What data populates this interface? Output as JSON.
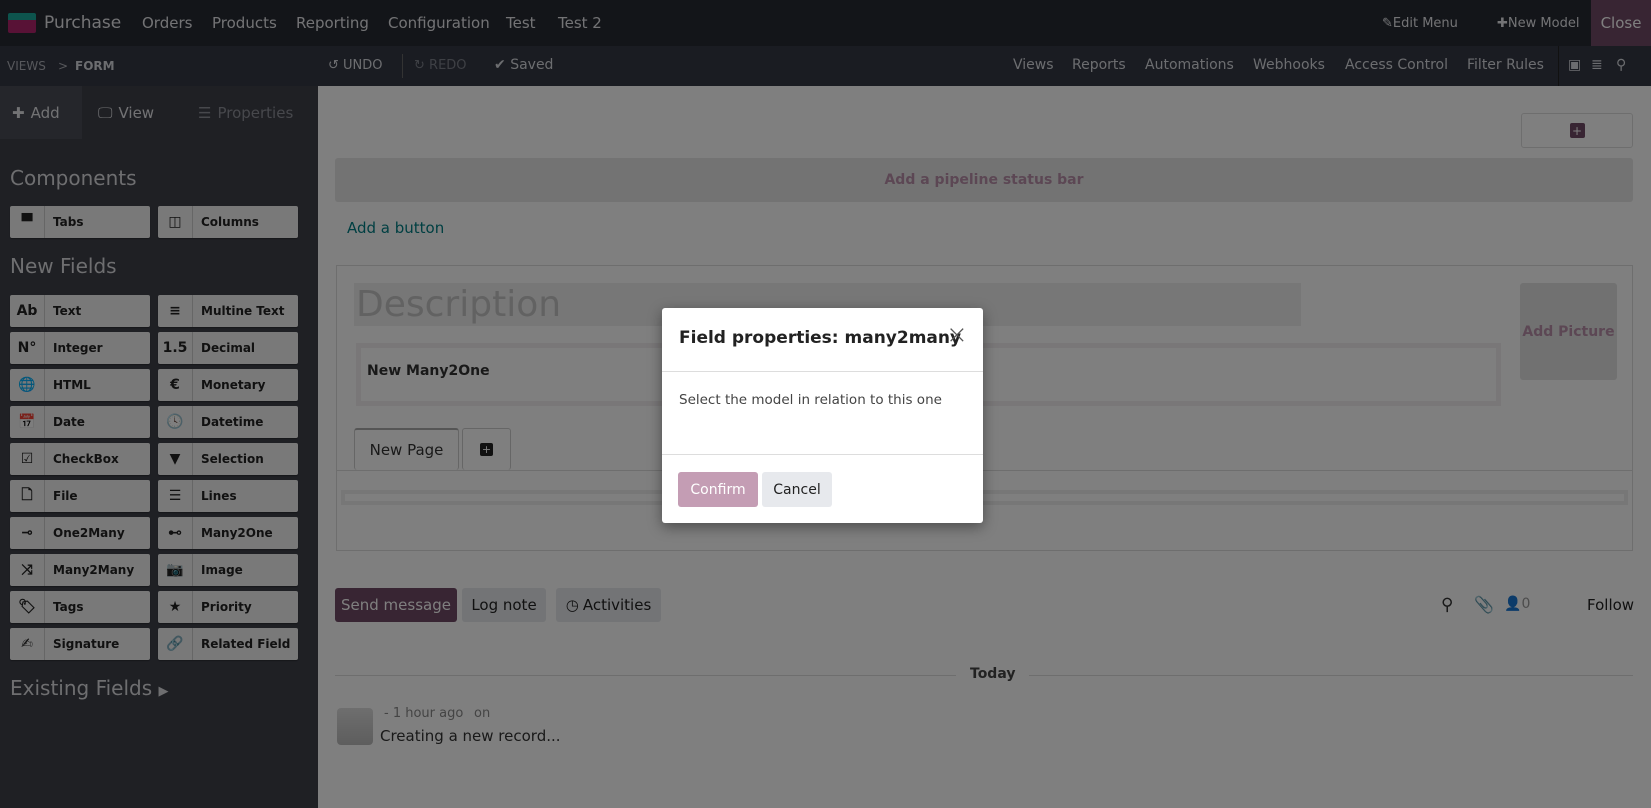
{
  "topnav": {
    "app": "Purchase",
    "menus": [
      "Orders",
      "Products",
      "Reporting",
      "Configuration",
      "Test",
      "Test 2"
    ],
    "edit_menu": "Edit Menu",
    "new_model": "New Model",
    "close": "Close"
  },
  "subbar": {
    "breadcrumb_root": "VIEWS",
    "breadcrumb_sep": ">",
    "breadcrumb_current": "FORM",
    "undo": "UNDO",
    "redo": "REDO",
    "saved": "Saved",
    "links": [
      "Views",
      "Reports",
      "Automations",
      "Webhooks",
      "Access Control",
      "Filter Rules"
    ]
  },
  "sidebar": {
    "tabs": {
      "add": "Add",
      "view": "View",
      "properties": "Properties"
    },
    "components_title": "Components",
    "components": [
      {
        "icon": "tabs-icon",
        "glyph": "▀",
        "label": "Tabs"
      },
      {
        "icon": "columns-icon",
        "glyph": "◫",
        "label": "Columns"
      }
    ],
    "new_fields_title": "New Fields",
    "fields": [
      {
        "icon": "text-icon",
        "glyph": "Ab",
        "label": "Text"
      },
      {
        "icon": "multiline-icon",
        "glyph": "≡",
        "label": "Multine Text"
      },
      {
        "icon": "integer-icon",
        "glyph": "N°",
        "label": "Integer"
      },
      {
        "icon": "decimal-icon",
        "glyph": "1.5",
        "label": "Decimal"
      },
      {
        "icon": "globe-icon",
        "glyph": "🌐",
        "label": "HTML"
      },
      {
        "icon": "euro-icon",
        "glyph": "€",
        "label": "Monetary"
      },
      {
        "icon": "calendar-icon",
        "glyph": "📅",
        "label": "Date"
      },
      {
        "icon": "clock-calendar-icon",
        "glyph": "🕓",
        "label": "Datetime"
      },
      {
        "icon": "checkbox-icon",
        "glyph": "☑",
        "label": "CheckBox"
      },
      {
        "icon": "caret-down-icon",
        "glyph": "▼",
        "label": "Selection"
      },
      {
        "icon": "file-icon",
        "glyph": "🗋",
        "label": "File"
      },
      {
        "icon": "list-icon",
        "glyph": "☰",
        "label": "Lines"
      },
      {
        "icon": "one2many-icon",
        "glyph": "⊸",
        "label": "One2Many"
      },
      {
        "icon": "many2one-icon",
        "glyph": "⊷",
        "label": "Many2One"
      },
      {
        "icon": "many2many-icon",
        "glyph": "⤨",
        "label": "Many2Many"
      },
      {
        "icon": "camera-icon",
        "glyph": "📷",
        "label": "Image"
      },
      {
        "icon": "tag-icon",
        "glyph": "🏷",
        "label": "Tags"
      },
      {
        "icon": "star-icon",
        "glyph": "★",
        "label": "Priority"
      },
      {
        "icon": "signature-icon",
        "glyph": "✍",
        "label": "Signature"
      },
      {
        "icon": "link-icon",
        "glyph": "🔗",
        "label": "Related Field"
      }
    ],
    "existing_fields": "Existing Fields"
  },
  "form": {
    "pipeline": "Add a pipeline status bar",
    "add_button": "Add a button",
    "description_placeholder": "Description",
    "many2one_label": "New Many2One",
    "add_picture": "Add Picture",
    "page_tab": "New Page"
  },
  "chatter": {
    "send_message": "Send message",
    "log_note": "Log note",
    "activities": "Activities",
    "followers": "0",
    "follow": "Follow",
    "today": "Today",
    "message_meta": "- 1 hour ago",
    "message_on": "on",
    "message_body": "Creating a new record..."
  },
  "modal": {
    "title": "Field properties: many2many",
    "body": "Select the model in relation to this one",
    "confirm": "Confirm",
    "cancel": "Cancel"
  },
  "colors": {
    "brand": "#714b67",
    "link": "#017e84"
  }
}
